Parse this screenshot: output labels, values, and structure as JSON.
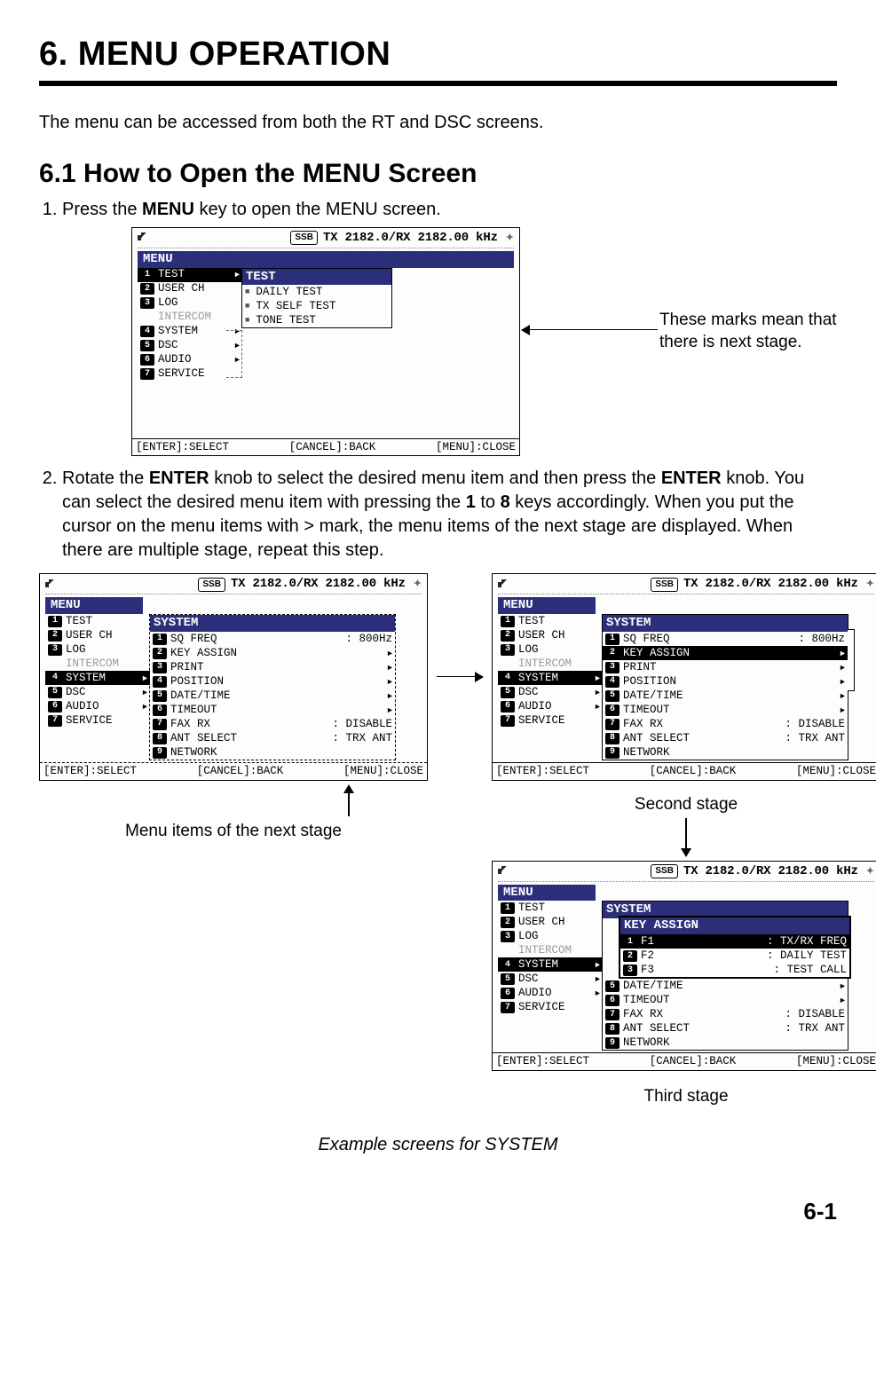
{
  "chapter_title": "6.    MENU OPERATION",
  "intro": "The menu can be accessed from both the RT and DSC screens.",
  "section_title": "6.1      How to Open the MENU Screen",
  "step1_a": "Press the ",
  "step1_key": "MENU",
  "step1_b": " key to open the MENU screen.",
  "annot_marks": "These marks mean that there is next stage.",
  "step2_a": "Rotate the ",
  "step2_k1": "ENTER",
  "step2_b": " knob to select the desired menu item and then press the ",
  "step2_k2": "ENTER",
  "step2_c": " knob. You can select the desired menu item with pressing the ",
  "step2_k3": "1",
  "step2_d": " to ",
  "step2_k4": "8",
  "step2_e": " keys accordingly. When you put the cursor on the menu items with > mark, the menu items of the next stage are displayed. When there are multiple stage, repeat this step.",
  "cap_next_stage": "Menu items of the next stage",
  "cap_second": "Second stage",
  "cap_third": "Third stage",
  "fig_caption": "Example screens for SYSTEM",
  "page_number": "6-1",
  "freq_line": "TX 2182.0/RX 2182.00 kHz",
  "ssb": "SSB",
  "menu_label": "MENU",
  "bottom_enter": "[ENTER]:SELECT",
  "bottom_cancel": "[CANCEL]:BACK",
  "bottom_menu": "[MENU]:CLOSE",
  "screen1": {
    "left": [
      {
        "n": "1",
        "t": "TEST",
        "sel": true,
        "arrow": true
      },
      {
        "n": "2",
        "t": "USER CH"
      },
      {
        "n": "3",
        "t": "LOG"
      },
      {
        "n": "",
        "t": "INTERCOM",
        "dim": true
      },
      {
        "n": "4",
        "t": "SYSTEM",
        "arrow": true,
        "dash": true
      },
      {
        "n": "5",
        "t": "DSC",
        "arrow": true,
        "dash": true
      },
      {
        "n": "6",
        "t": "AUDIO",
        "arrow": true,
        "dash": true
      },
      {
        "n": "7",
        "t": "SERVICE"
      }
    ],
    "sub_title": "TEST",
    "sub": [
      {
        "t": "DAILY TEST"
      },
      {
        "t": "TX SELF TEST"
      },
      {
        "t": "TONE TEST"
      }
    ]
  },
  "screen2": {
    "left_sel": "SYSTEM",
    "left": [
      {
        "n": "1",
        "t": "TEST"
      },
      {
        "n": "2",
        "t": "USER CH"
      },
      {
        "n": "3",
        "t": "LOG"
      },
      {
        "n": "",
        "t": "INTERCOM",
        "dim": true
      },
      {
        "n": "4",
        "t": "SYSTEM",
        "sel": true,
        "arrow": true
      },
      {
        "n": "5",
        "t": "DSC",
        "arrow": true
      },
      {
        "n": "6",
        "t": "AUDIO",
        "arrow": true
      },
      {
        "n": "7",
        "t": "SERVICE"
      }
    ],
    "sub_title": "SYSTEM",
    "sub": [
      {
        "n": "1",
        "t": "SQ FREQ",
        "v": ": 800Hz"
      },
      {
        "n": "2",
        "t": "KEY ASSIGN",
        "arrow": true
      },
      {
        "n": "3",
        "t": "PRINT",
        "arrow": true
      },
      {
        "n": "4",
        "t": "POSITION",
        "arrow": true
      },
      {
        "n": "5",
        "t": "DATE/TIME",
        "arrow": true
      },
      {
        "n": "6",
        "t": "TIMEOUT",
        "arrow": true
      },
      {
        "n": "7",
        "t": "FAX RX",
        "v": ": DISABLE"
      },
      {
        "n": "8",
        "t": "ANT SELECT",
        "v": ": TRX ANT"
      },
      {
        "n": "9",
        "t": "NETWORK"
      }
    ]
  },
  "screen3": {
    "sub_title": "SYSTEM",
    "sub_sel": "KEY ASSIGN",
    "sub": [
      {
        "n": "1",
        "t": "SQ FREQ",
        "v": ": 800Hz"
      },
      {
        "n": "2",
        "t": "KEY ASSIGN",
        "sel": true,
        "arrow": true
      },
      {
        "n": "3",
        "t": "PRINT",
        "arrow": true
      },
      {
        "n": "4",
        "t": "POSITION",
        "arrow": true
      },
      {
        "n": "5",
        "t": "DATE/TIME",
        "arrow": true
      },
      {
        "n": "6",
        "t": "TIMEOUT",
        "arrow": true
      },
      {
        "n": "7",
        "t": "FAX RX",
        "v": ": DISABLE"
      },
      {
        "n": "8",
        "t": "ANT SELECT",
        "v": ": TRX ANT"
      },
      {
        "n": "9",
        "t": "NETWORK"
      }
    ]
  },
  "screen4": {
    "sub_title": "SYSTEM",
    "third_title": "KEY ASSIGN",
    "third": [
      {
        "n": "1",
        "t": "F1",
        "v": ": TX/RX FREQ",
        "sel": true
      },
      {
        "n": "2",
        "t": "F2",
        "v": ": DAILY TEST"
      },
      {
        "n": "3",
        "t": "F3",
        "v": ": TEST CALL"
      }
    ],
    "tail": [
      {
        "n": "5",
        "t": "DATE/TIME",
        "arrow": true
      },
      {
        "n": "6",
        "t": "TIMEOUT",
        "arrow": true
      },
      {
        "n": "7",
        "t": "FAX RX",
        "v": ": DISABLE"
      },
      {
        "n": "8",
        "t": "ANT SELECT",
        "v": ": TRX ANT"
      },
      {
        "n": "9",
        "t": "NETWORK"
      }
    ]
  }
}
